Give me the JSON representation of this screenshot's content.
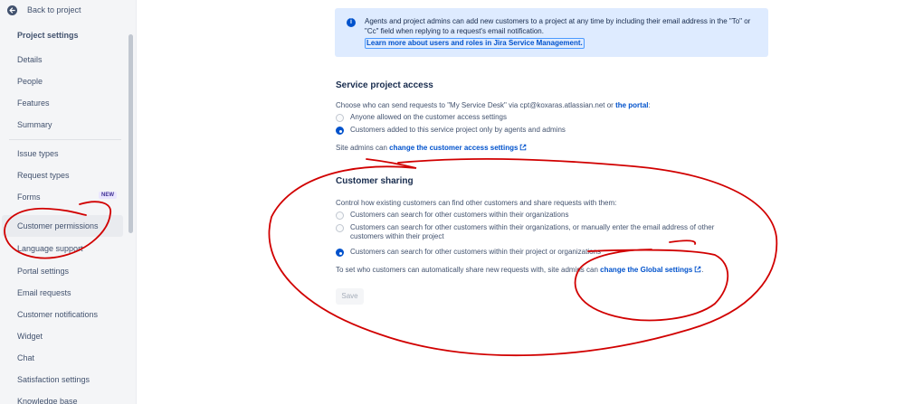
{
  "sidebar": {
    "back_label": "Back to project",
    "section_title": "Project settings",
    "group1": [
      "Details",
      "People",
      "Features",
      "Summary"
    ],
    "group2": [
      "Issue types",
      "Request types",
      "Forms",
      "Customer permissions",
      "Language support",
      "Portal settings",
      "Email requests",
      "Customer notifications",
      "Widget",
      "Chat",
      "Satisfaction settings",
      "Knowledge base"
    ],
    "new_badge": "NEW",
    "selected_item": "Customer permissions"
  },
  "info": {
    "text": "Agents and project admins can add new customers to a project at any time by including their email address in the \"To\" or \"Cc\" field when replying to a request's email notification.",
    "link": "Learn more about users and roles in Jira Service Management."
  },
  "access": {
    "heading": "Service project access",
    "desc_prefix": "Choose who can send requests to \"My Service Desk\" via cpt@koxaras.atlassian.net or ",
    "desc_link": "the portal",
    "desc_suffix": ":",
    "options": [
      {
        "label": "Anyone allowed on the customer access settings",
        "selected": false
      },
      {
        "label": "Customers added to this service project only by agents and admins",
        "selected": true
      }
    ],
    "site_admin_prefix": "Site admins can ",
    "site_admin_link": "change the customer access settings"
  },
  "sharing": {
    "heading": "Customer sharing",
    "desc": "Control how existing customers can find other customers and share requests with them:",
    "options": [
      {
        "label": "Customers can search for other customers within their organizations",
        "selected": false
      },
      {
        "label": "Customers can search for other customers within their organizations, or manually enter the email address of other customers within their project",
        "selected": false
      },
      {
        "label": "Customers can search for other customers within their project or organizations",
        "selected": true
      }
    ],
    "global_prefix": "To set who customers can automatically share new requests with, site admins can ",
    "global_link": "change the Global settings",
    "global_suffix": "."
  },
  "save_label": "Save",
  "colors": {
    "annotation": "#d10000",
    "link": "#0052cc",
    "info_bg": "#deebff",
    "radio_selected": "#0052cc"
  },
  "icons": [
    "arrow-left-icon",
    "info-icon",
    "external-link-icon"
  ]
}
